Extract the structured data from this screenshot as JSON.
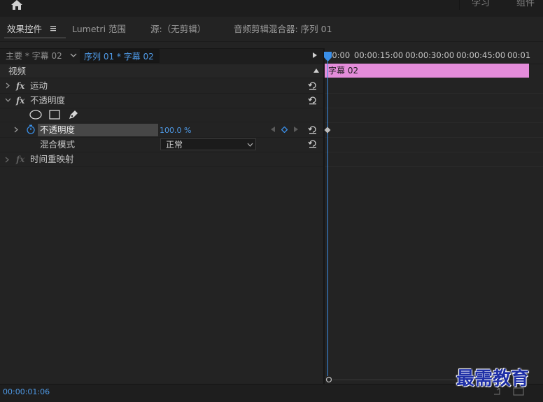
{
  "topbar": {
    "home_icon": "home-icon",
    "tabs": [
      {
        "label": "学习"
      },
      {
        "label": "组件"
      }
    ]
  },
  "panel_tabs": {
    "effect_controls": "效果控件",
    "effect_controls_menu_icon": "hamburger-menu-icon",
    "lumetri_scopes": "Lumetri 范围",
    "source": "源:（无剪辑）",
    "audio_mixer": "音频剪辑混合器: 序列 01"
  },
  "source_header": {
    "master": "主要 * 字幕 02",
    "sequence": "序列 01 * 字幕 02"
  },
  "effects": {
    "video_section": "视频",
    "motion": {
      "fx": "fx",
      "label": "运动"
    },
    "opacity": {
      "fx": "fx",
      "label": "不透明度"
    },
    "mask_tools": [
      "ellipse-mask-icon",
      "rectangle-mask-icon",
      "pen-mask-icon"
    ],
    "opacity_param": {
      "label": "不透明度",
      "value": "100.0 %"
    },
    "blend_mode": {
      "label": "混合模式",
      "value": "正常"
    },
    "time_remap": {
      "fx": "fx",
      "label": "时间重映射"
    }
  },
  "timeline": {
    "ticks": [
      "00:00",
      "00:00:15:00",
      "00:00:30:00",
      "00:00:45:00",
      "00:01"
    ],
    "clip_label": "字幕 02",
    "clip_color": "#e48cda",
    "playhead_color": "#3a8fe8"
  },
  "status": {
    "timecode": "00:00:01:06"
  },
  "watermark": "最需教育",
  "colors": {
    "accent_blue": "#4f9be8",
    "panel_bg": "#232323"
  }
}
